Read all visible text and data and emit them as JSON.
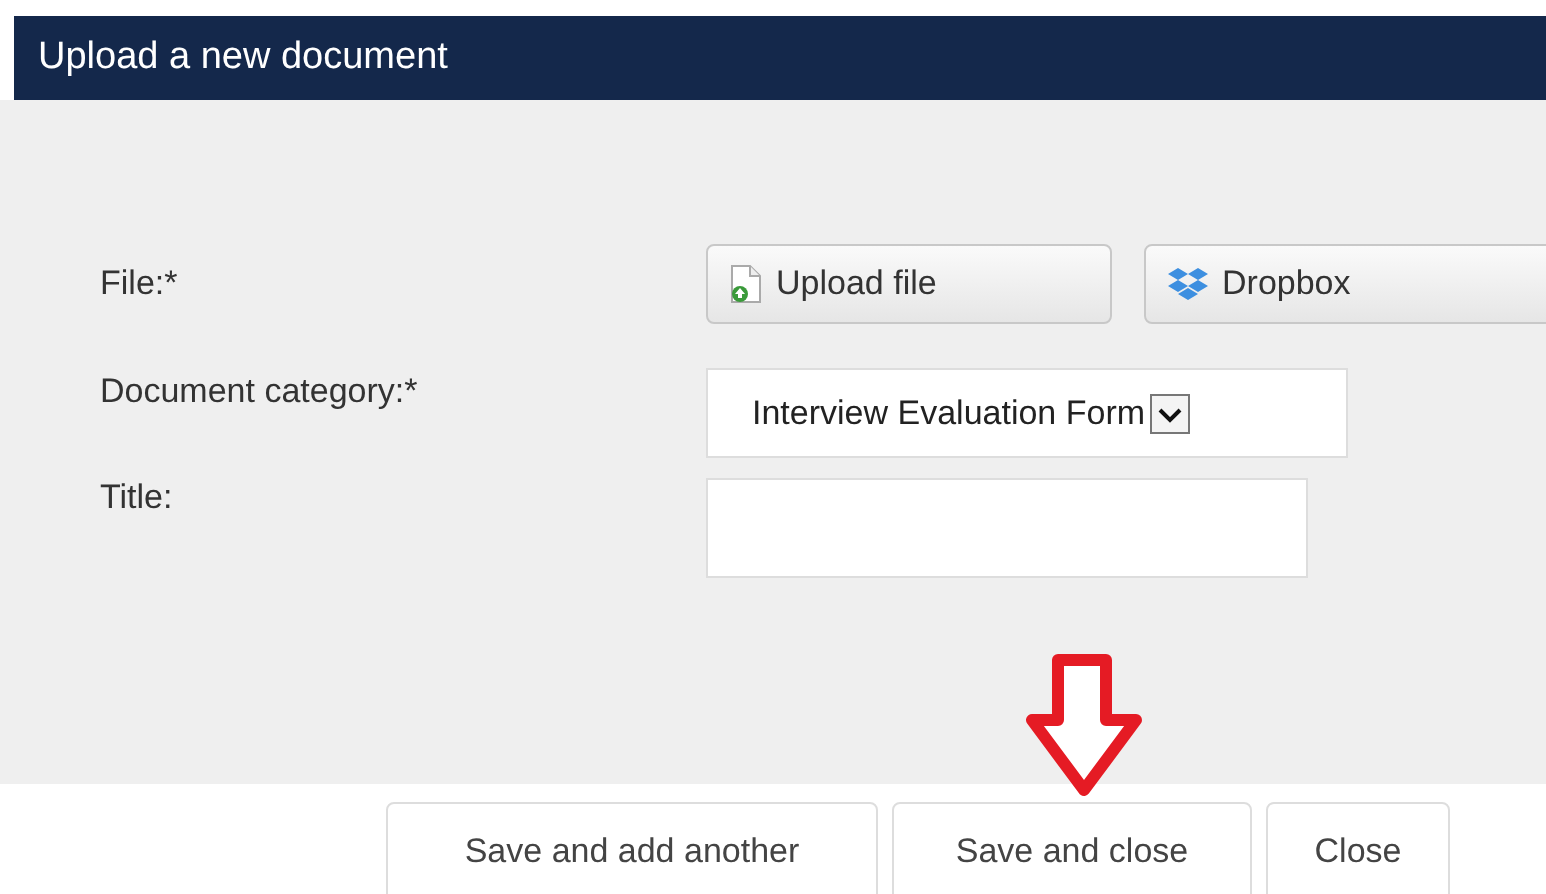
{
  "window": {
    "title": "Upload a new document"
  },
  "fields": [
    {
      "kind": "file",
      "label": "File:*",
      "buttons": [
        {
          "kind": "upload",
          "label": "Upload file"
        },
        {
          "kind": "dropbox",
          "label": "Dropbox"
        }
      ]
    },
    {
      "kind": "select",
      "label": "Document category:*",
      "value": "Interview Evaluation Form"
    },
    {
      "kind": "text",
      "label": "Title:"
    }
  ],
  "footer_buttons": [
    "Save and add another",
    "Save and close",
    "Close"
  ]
}
